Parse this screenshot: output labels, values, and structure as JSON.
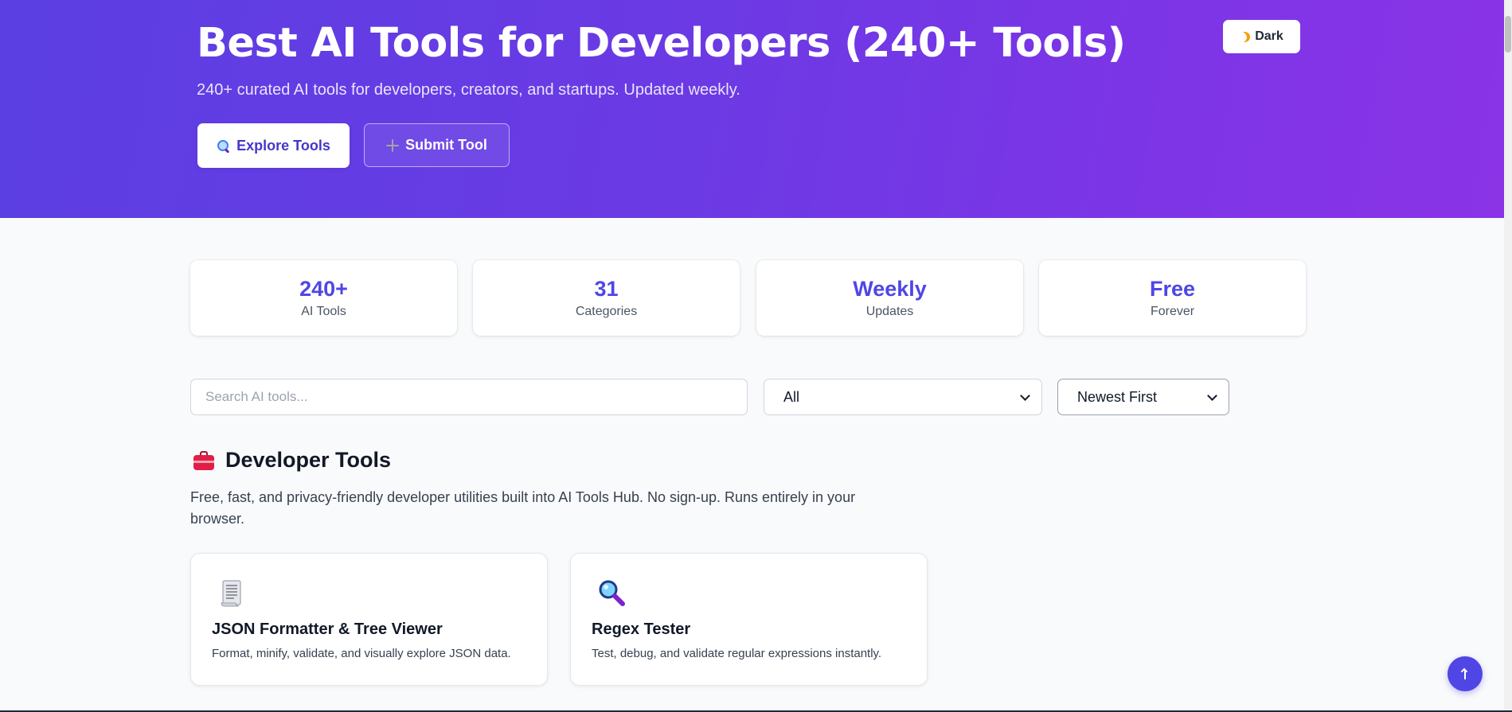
{
  "hero": {
    "title": "Best AI Tools for Developers (240+ Tools)",
    "subtitle": "240+ curated AI tools for developers, creators, and startups. Updated weekly.",
    "explore_label": "Explore Tools",
    "submit_label": "Submit Tool",
    "theme_toggle_label": "Dark"
  },
  "stats": [
    {
      "value": "240+",
      "label": "AI Tools"
    },
    {
      "value": "31",
      "label": "Categories"
    },
    {
      "value": "Weekly",
      "label": "Updates"
    },
    {
      "value": "Free",
      "label": "Forever"
    }
  ],
  "filters": {
    "search_placeholder": "Search AI tools...",
    "category_selected": "All",
    "sort_selected": "Newest First"
  },
  "section": {
    "title": "Developer Tools",
    "description": "Free, fast, and privacy-friendly developer utilities built into AI Tools Hub. No sign-up. Runs entirely in your browser."
  },
  "tools": [
    {
      "name": "JSON Formatter & Tree Viewer",
      "description": "Format, minify, validate, and visually explore JSON data.",
      "icon": "page-with-curl-icon"
    },
    {
      "name": "Regex Tester",
      "description": "Test, debug, and validate regular expressions instantly.",
      "icon": "magnifying-glass-icon"
    }
  ],
  "colors": {
    "hero_gradient_start": "#5b3fe3",
    "hero_gradient_end": "#8a34e6",
    "accent": "#4f46e5",
    "page_background": "#f9fafb"
  }
}
